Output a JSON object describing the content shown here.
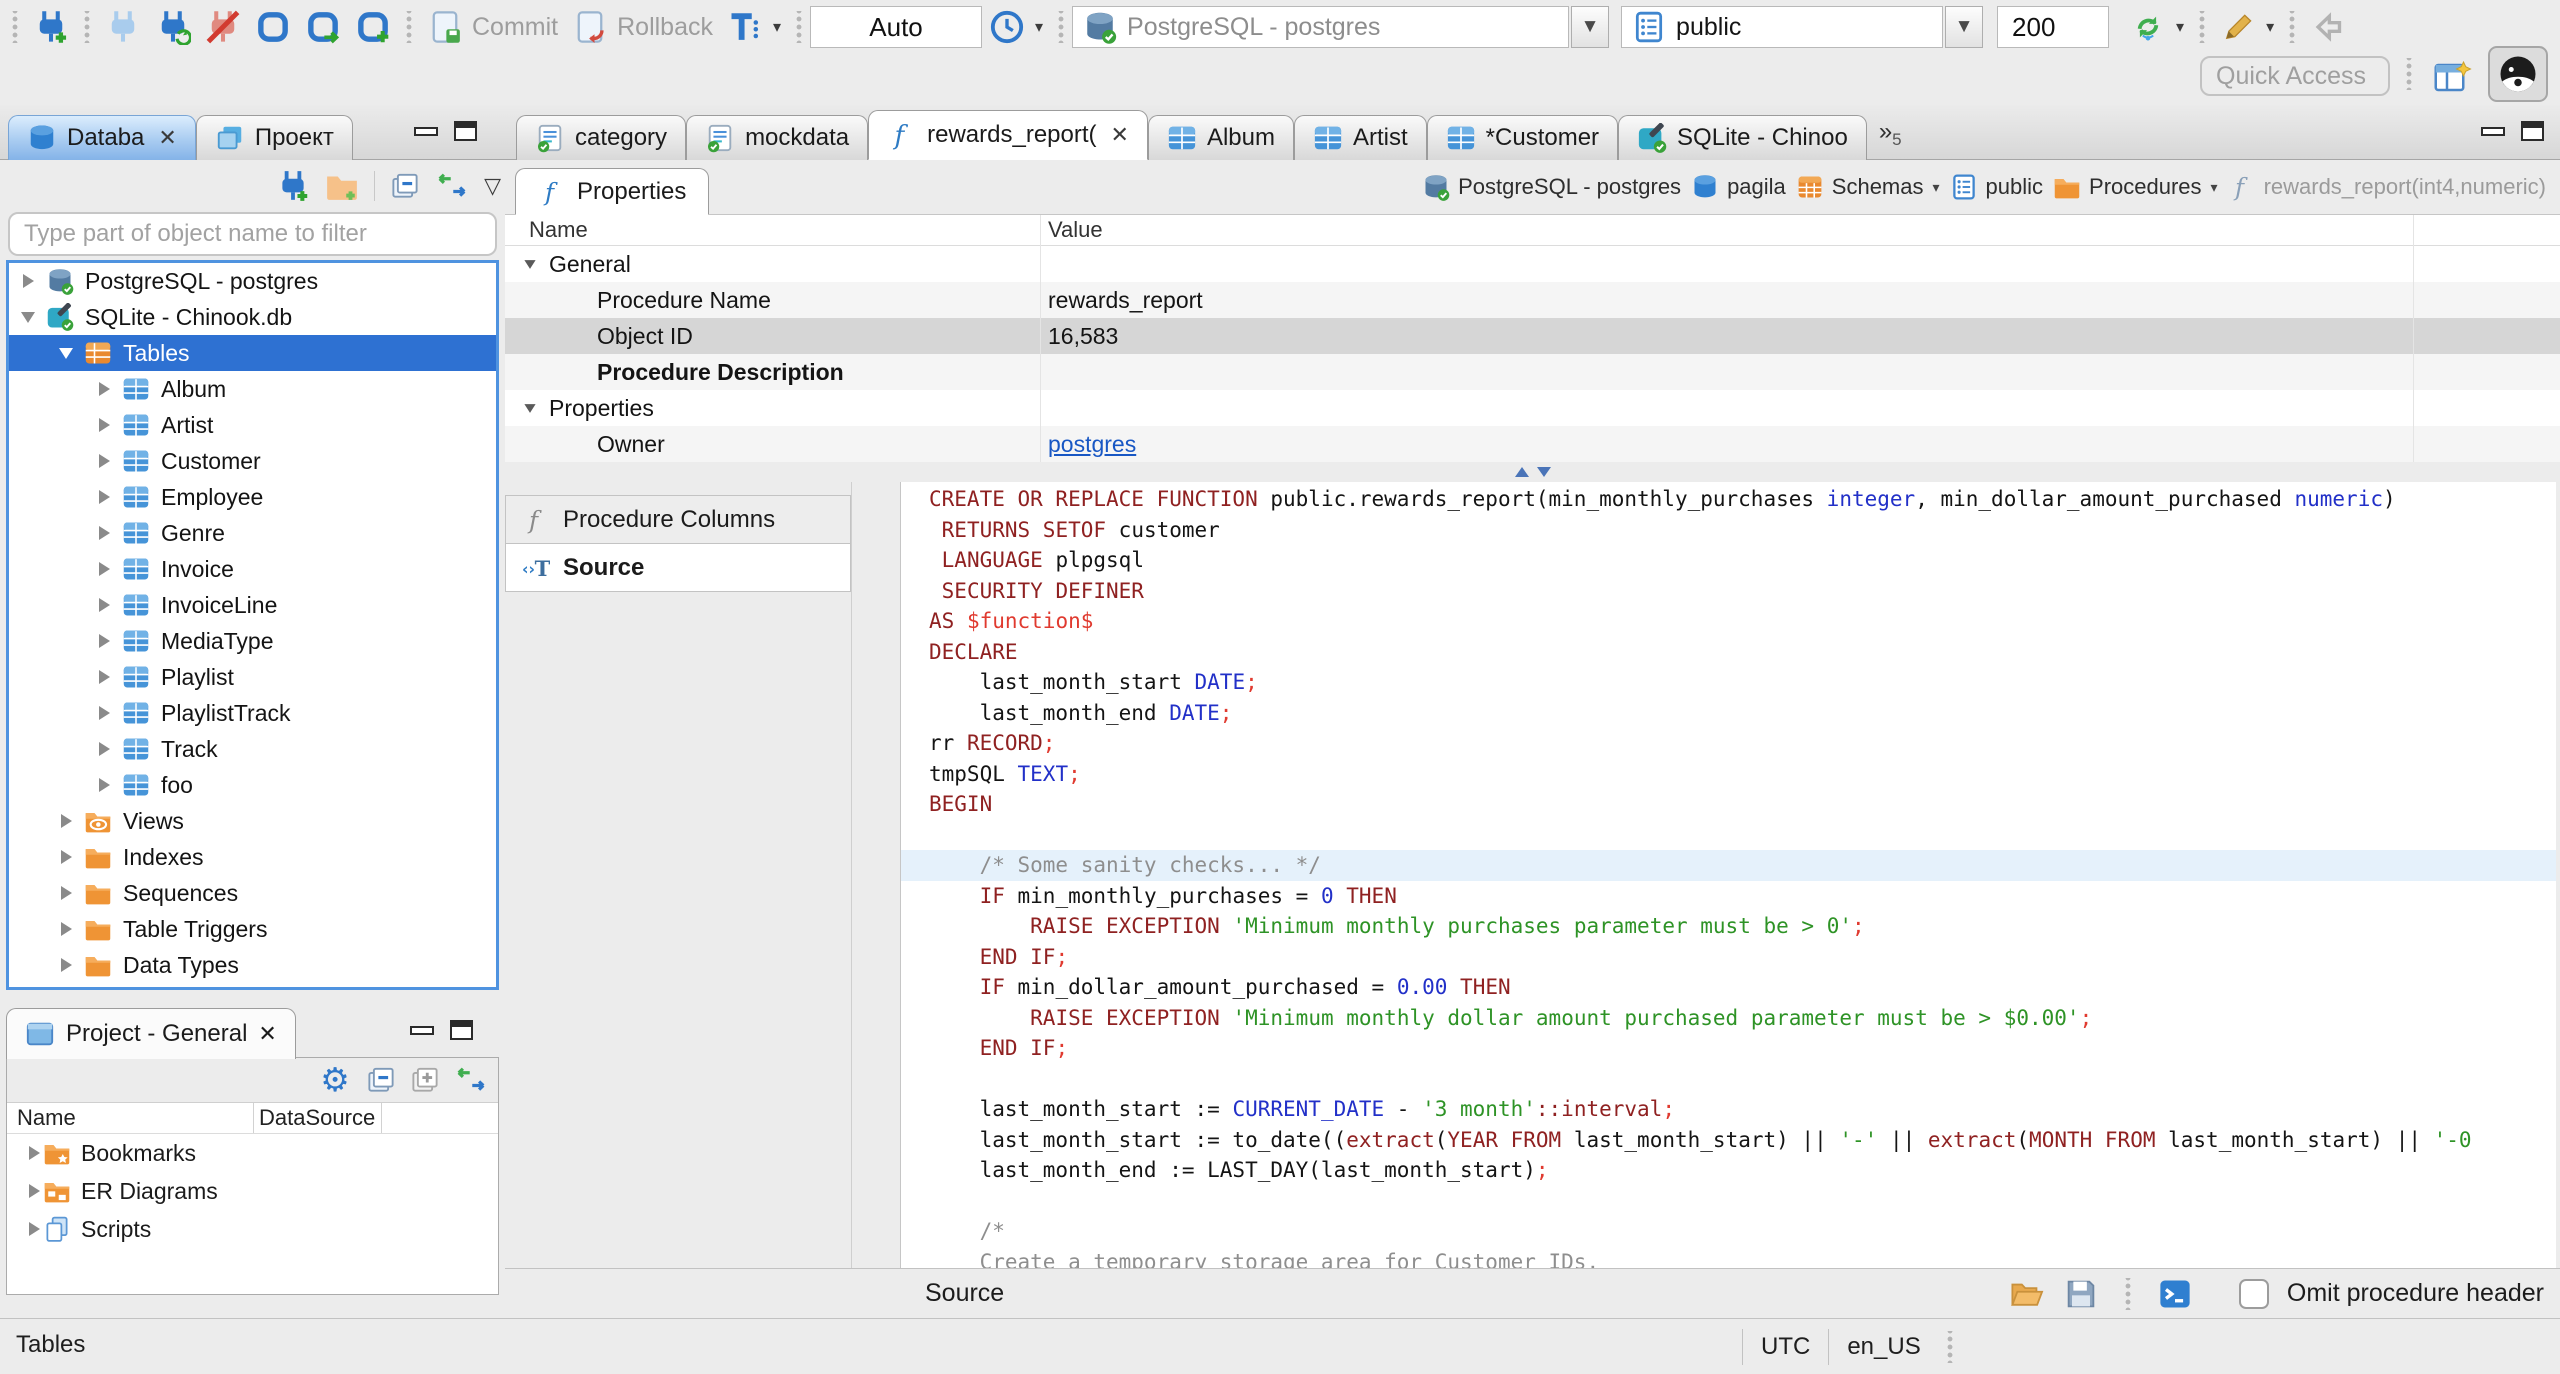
{
  "toolbar": {
    "commit": "Commit",
    "rollback": "Rollback",
    "auto": "Auto",
    "connection": "PostgreSQL - postgres",
    "schema": "public",
    "fetch_size": "200",
    "quick_access": "Quick Access"
  },
  "tabs": {
    "overflow_count": "5",
    "editor_tabs": [
      {
        "label": "category",
        "icon": "sql-file"
      },
      {
        "label": "mockdata",
        "icon": "sql-file"
      },
      {
        "label": "rewards_report(",
        "icon": "func",
        "active": true,
        "closable": true
      },
      {
        "label": "Album",
        "icon": "table"
      },
      {
        "label": "Artist",
        "icon": "table"
      },
      {
        "label": "*Customer",
        "icon": "table"
      },
      {
        "label": "SQLite - Chinoo",
        "icon": "db-sqlite"
      }
    ]
  },
  "left_panel": {
    "tabs": [
      {
        "label": "Databa",
        "icon": "db-cyl",
        "active": true,
        "closable": true
      },
      {
        "label": "Проект",
        "icon": "windows"
      }
    ],
    "filter_placeholder": "Type part of object name to filter",
    "tree": [
      {
        "label": "PostgreSQL - postgres",
        "icon": "db-pg",
        "depth": 0,
        "arrow": "r"
      },
      {
        "label": "SQLite - Chinook.db",
        "icon": "db-sqlite",
        "depth": 0,
        "arrow": "d"
      },
      {
        "label": "Tables",
        "icon": "tables",
        "depth": 1,
        "arrow": "d",
        "selected": true
      },
      {
        "label": "Album",
        "icon": "table",
        "depth": 2,
        "arrow": "r"
      },
      {
        "label": "Artist",
        "icon": "table",
        "depth": 2,
        "arrow": "r"
      },
      {
        "label": "Customer",
        "icon": "table",
        "depth": 2,
        "arrow": "r"
      },
      {
        "label": "Employee",
        "icon": "table",
        "depth": 2,
        "arrow": "r"
      },
      {
        "label": "Genre",
        "icon": "table",
        "depth": 2,
        "arrow": "r"
      },
      {
        "label": "Invoice",
        "icon": "table",
        "depth": 2,
        "arrow": "r"
      },
      {
        "label": "InvoiceLine",
        "icon": "table",
        "depth": 2,
        "arrow": "r"
      },
      {
        "label": "MediaType",
        "icon": "table",
        "depth": 2,
        "arrow": "r"
      },
      {
        "label": "Playlist",
        "icon": "table",
        "depth": 2,
        "arrow": "r"
      },
      {
        "label": "PlaylistTrack",
        "icon": "table",
        "depth": 2,
        "arrow": "r"
      },
      {
        "label": "Track",
        "icon": "table",
        "depth": 2,
        "arrow": "r"
      },
      {
        "label": "foo",
        "icon": "table",
        "depth": 2,
        "arrow": "r"
      },
      {
        "label": "Views",
        "icon": "views",
        "depth": 1,
        "arrow": "r"
      },
      {
        "label": "Indexes",
        "icon": "folder",
        "depth": 1,
        "arrow": "r"
      },
      {
        "label": "Sequences",
        "icon": "folder",
        "depth": 1,
        "arrow": "r"
      },
      {
        "label": "Table Triggers",
        "icon": "folder",
        "depth": 1,
        "arrow": "r"
      },
      {
        "label": "Data Types",
        "icon": "folder",
        "depth": 1,
        "arrow": "r"
      }
    ]
  },
  "project": {
    "title": "Project - General",
    "columns": [
      "Name",
      "DataSource"
    ],
    "items": [
      {
        "label": "Bookmarks",
        "icon": "bookmarks"
      },
      {
        "label": "ER Diagrams",
        "icon": "er"
      },
      {
        "label": "Scripts",
        "icon": "scripts"
      }
    ]
  },
  "properties": {
    "tab_label": "Properties",
    "breadcrumb": [
      {
        "label": "PostgreSQL - postgres",
        "icon": "db-pg"
      },
      {
        "label": "pagila",
        "icon": "db-cyl"
      },
      {
        "label": "Schemas",
        "icon": "schemas",
        "caret": true
      },
      {
        "label": "public",
        "icon": "schema"
      },
      {
        "label": "Procedures",
        "icon": "folder",
        "caret": true
      },
      {
        "label": "rewards_report(int4,numeric)",
        "icon": "func",
        "dim": true
      }
    ],
    "columns": {
      "name": "Name",
      "value": "Value"
    },
    "rows": [
      {
        "kind": "group",
        "name": "General"
      },
      {
        "kind": "prop",
        "name": "Procedure Name",
        "value": "rewards_report"
      },
      {
        "kind": "prop",
        "name": "Object ID",
        "value": "16,583",
        "selected": true
      },
      {
        "kind": "prop",
        "name": "Procedure Description",
        "value": "",
        "bold": true
      },
      {
        "kind": "group",
        "name": "Properties"
      },
      {
        "kind": "prop",
        "name": "Owner",
        "value": "postgres",
        "link": true
      }
    ]
  },
  "editor": {
    "subtabs": [
      {
        "label": "Procedure Columns",
        "icon": "func"
      },
      {
        "label": "Source",
        "icon": "src",
        "active": true
      }
    ],
    "bottom": {
      "source_label": "Source",
      "omit_label": "Omit procedure header"
    },
    "code": {
      "current_line": 12,
      "lines": [
        [
          [
            "k",
            "CREATE OR REPLACE FUNCTION "
          ],
          [
            "p",
            "public.rewards_report(min_monthly_purchases "
          ],
          [
            "t",
            "integer"
          ],
          [
            "p",
            ", min_dollar_amount_purchased "
          ],
          [
            "t",
            "numeric"
          ],
          [
            "p",
            ")"
          ]
        ],
        [
          [
            "p",
            " "
          ],
          [
            "k",
            "RETURNS SETOF"
          ],
          [
            "p",
            " customer"
          ]
        ],
        [
          [
            "p",
            " "
          ],
          [
            "k",
            "LANGUAGE"
          ],
          [
            "p",
            " plpgsql"
          ]
        ],
        [
          [
            "p",
            " "
          ],
          [
            "k",
            "SECURITY DEFINER"
          ]
        ],
        [
          [
            "k",
            "AS "
          ],
          [
            "r",
            "$function$"
          ]
        ],
        [
          [
            "k",
            "DECLARE"
          ]
        ],
        [
          [
            "p",
            "    last_month_start "
          ],
          [
            "t",
            "DATE"
          ],
          [
            "r",
            ";"
          ]
        ],
        [
          [
            "p",
            "    last_month_end "
          ],
          [
            "t",
            "DATE"
          ],
          [
            "r",
            ";"
          ]
        ],
        [
          [
            "p",
            "rr "
          ],
          [
            "k",
            "RECORD"
          ],
          [
            "r",
            ";"
          ]
        ],
        [
          [
            "p",
            "tmpSQL "
          ],
          [
            "t",
            "TEXT"
          ],
          [
            "r",
            ";"
          ]
        ],
        [
          [
            "k",
            "BEGIN"
          ]
        ],
        [],
        [
          [
            "c",
            "    /* Some sanity checks... */"
          ]
        ],
        [
          [
            "p",
            "    "
          ],
          [
            "k",
            "IF"
          ],
          [
            "p",
            " min_monthly_purchases = "
          ],
          [
            "n",
            "0"
          ],
          [
            "p",
            " "
          ],
          [
            "k",
            "THEN"
          ]
        ],
        [
          [
            "p",
            "        "
          ],
          [
            "k",
            "RAISE EXCEPTION"
          ],
          [
            "p",
            " "
          ],
          [
            "s",
            "'Minimum monthly purchases parameter must be > 0'"
          ],
          [
            "r",
            ";"
          ]
        ],
        [
          [
            "p",
            "    "
          ],
          [
            "k",
            "END IF"
          ],
          [
            "r",
            ";"
          ]
        ],
        [
          [
            "p",
            "    "
          ],
          [
            "k",
            "IF"
          ],
          [
            "p",
            " min_dollar_amount_purchased = "
          ],
          [
            "n",
            "0.00"
          ],
          [
            "p",
            " "
          ],
          [
            "k",
            "THEN"
          ]
        ],
        [
          [
            "p",
            "        "
          ],
          [
            "k",
            "RAISE EXCEPTION"
          ],
          [
            "p",
            " "
          ],
          [
            "s",
            "'Minimum monthly dollar amount purchased parameter must be > $0.00'"
          ],
          [
            "r",
            ";"
          ]
        ],
        [
          [
            "p",
            "    "
          ],
          [
            "k",
            "END IF"
          ],
          [
            "r",
            ";"
          ]
        ],
        [],
        [
          [
            "p",
            "    last_month_start := "
          ],
          [
            "t",
            "CURRENT_DATE"
          ],
          [
            "p",
            " - "
          ],
          [
            "s",
            "'3 month'"
          ],
          [
            "k",
            "::interval"
          ],
          [
            "r",
            ";"
          ]
        ],
        [
          [
            "p",
            "    last_month_start := to_date(("
          ],
          [
            "k",
            "extract"
          ],
          [
            "p",
            "("
          ],
          [
            "k",
            "YEAR FROM"
          ],
          [
            "p",
            " last_month_start) || "
          ],
          [
            "s",
            "'-'"
          ],
          [
            "p",
            " || "
          ],
          [
            "k",
            "extract"
          ],
          [
            "p",
            "("
          ],
          [
            "k",
            "MONTH FROM"
          ],
          [
            "p",
            " last_month_start) || "
          ],
          [
            "s",
            "'-0"
          ]
        ],
        [
          [
            "p",
            "    last_month_end := LAST_DAY(last_month_start)"
          ],
          [
            "r",
            ";"
          ]
        ],
        [],
        [
          [
            "c",
            "    /*"
          ]
        ],
        [
          [
            "c",
            "    Create a temporary storage area for Customer IDs."
          ]
        ],
        [
          [
            "c",
            "    */"
          ]
        ]
      ]
    }
  },
  "status": {
    "left": "Tables",
    "timezone": "UTC",
    "locale": "en_US"
  }
}
